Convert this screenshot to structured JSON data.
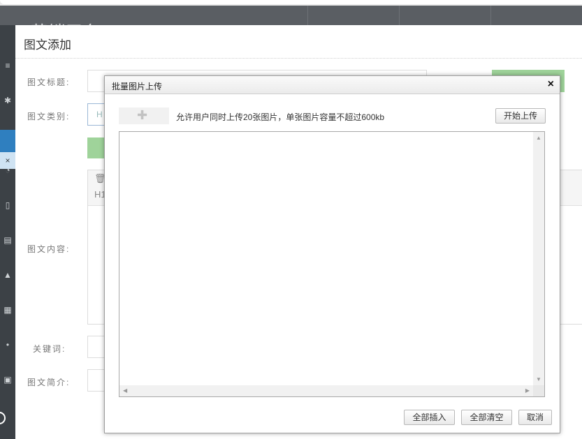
{
  "app": {
    "brand": "MY营销平台"
  },
  "page": {
    "title": "图文添加",
    "labels": {
      "title": "图文标题:",
      "category": "图文类别:",
      "content": "图文内容:",
      "keywords": "关键词:",
      "summary": "图文简介:"
    },
    "category_placeholder": "H",
    "editor_toolbar_1": "🗑",
    "editor_toolbar_2": "H1"
  },
  "modal": {
    "title": "批量图片上传",
    "close": "×",
    "hint": "允许用户同时上传20张图片，单张图片容量不超过600kb",
    "start_upload": "开始上传",
    "insert_all": "全部插入",
    "clear_all": "全部清空",
    "cancel": "取消"
  },
  "icons": {
    "plugin": "puzzle-icon",
    "close": "close-icon"
  },
  "colors": {
    "green_button": "#9fd39a",
    "sidebar_active": "#2f7fbf"
  }
}
